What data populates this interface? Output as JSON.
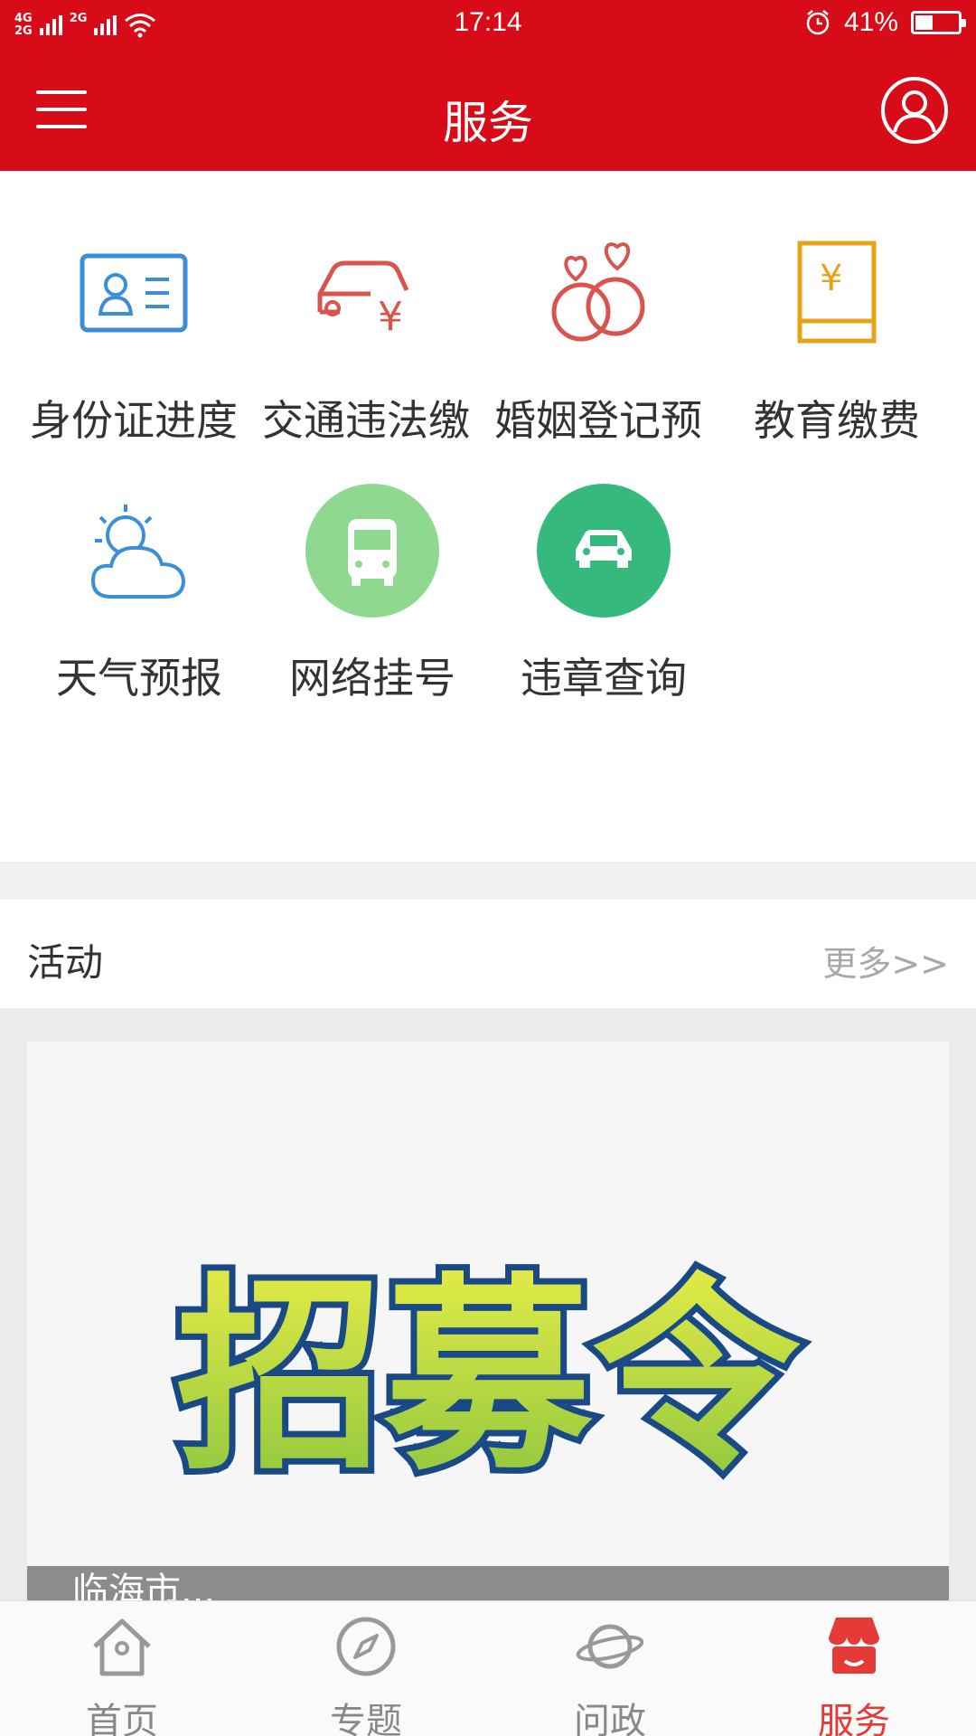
{
  "status_bar": {
    "network_top": "4G",
    "network_bottom": "2G",
    "network2": "2G",
    "time": "17:14",
    "battery": "41%",
    "battery_level": 0.41
  },
  "header": {
    "title": "服务"
  },
  "services": [
    {
      "label": "身份证进度",
      "icon": "id-card-icon"
    },
    {
      "label": "交通违法缴",
      "icon": "car-fine-icon"
    },
    {
      "label": "婚姻登记预",
      "icon": "rings-icon"
    },
    {
      "label": "教育缴费",
      "icon": "book-fee-icon"
    },
    {
      "label": "天气预报",
      "icon": "weather-icon"
    },
    {
      "label": "网络挂号",
      "icon": "bus-icon"
    },
    {
      "label": "违章查询",
      "icon": "car-icon"
    }
  ],
  "activity": {
    "title": "活动",
    "more": "更多>>",
    "banner_text": "招募令",
    "banner_caption": "临海市..."
  },
  "tabbar": [
    {
      "label": "首页",
      "icon": "home-icon",
      "active": false
    },
    {
      "label": "专题",
      "icon": "compass-icon",
      "active": false
    },
    {
      "label": "问政",
      "icon": "planet-icon",
      "active": false
    },
    {
      "label": "服务",
      "icon": "store-icon",
      "active": true
    }
  ],
  "colors": {
    "brand_red": "#d80c18",
    "tab_active": "#e53a36",
    "icon_blue": "#3d8ed8",
    "icon_red": "#d9534f",
    "icon_orange": "#e6a317",
    "bus_green": "#8fd88f",
    "car_green": "#35b97d"
  }
}
